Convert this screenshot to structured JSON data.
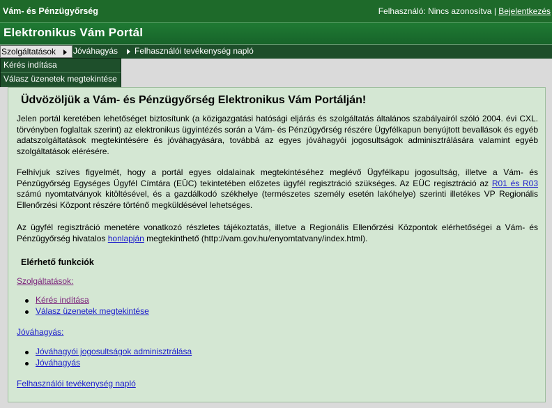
{
  "header": {
    "brand": "Vám- és Pénzügyőrség",
    "user_label": "Felhasználó: Nincs azonosítva",
    "separator": "|",
    "login_link": "Bejelentkezés"
  },
  "portal_title": "Elektronikus Vám Portál",
  "menu": {
    "items": [
      {
        "label": "Szolgáltatások"
      },
      {
        "label": "Jóváhagyás"
      },
      {
        "label": "Felhasználói tevékenység napló"
      }
    ]
  },
  "dropdown": {
    "items": [
      {
        "label": "Kérés indítása"
      },
      {
        "label": "Válasz üzenetek megtekintése"
      }
    ]
  },
  "content": {
    "welcome": "Üdvözöljük a Vám- és Pénzügyőrség Elektronikus Vám Portálján!",
    "p1": "Jelen portál keretében lehetőséget biztosítunk (a közigazgatási hatósági eljárás és szolgáltatás általános szabályairól szóló 2004. évi CXL. törvényben foglaltak szerint) az elektronikus ügyintézés során a Vám- és Pénzügyőrség részére Ügyfélkapun benyújtott bevallások és egyéb adatszolgáltatások megtekintésére és jóváhagyására, továbbá az egyes jóváhagyói jogosultságok adminisztrálására valamint egyéb szolgáltatások elérésére.",
    "p2_before": "Felhívjuk szíves figyelmét, hogy a portál egyes oldalainak megtekintéséhez meglévő Ügyfélkapu jogosultság, illetve a Vám- és Pénzügyőrség Egységes Ügyfél Címtára (EÜC) tekintetében előzetes ügyfél regisztráció szükséges. Az EÜC regisztráció az ",
    "p2_link": "R01 és R03",
    "p2_after": " számú nyomtatványok kitöltésével, és a gazdálkodó székhelye (természetes személy esetén lakóhelye) szerinti illetékes VP Regionális Ellenőrzési Központ részére történő megküldésével lehetséges.",
    "p3_before": "Az ügyfél regisztráció menetére vonatkozó részletes tájékoztatás, illetve a Regionális Ellenőrzési Központok elérhetőségei a Vám- és Pénzügyőrség hivatalos ",
    "p3_link": "honlapján",
    "p3_after": " megtekinthető (http://vam.gov.hu/enyomtatvany/index.html).",
    "functions_title": "Elérhető funkciók",
    "sections": [
      {
        "title": "Szolgáltatások:",
        "links": [
          "Kérés indítása",
          "Válasz üzenetek megtekintése"
        ]
      },
      {
        "title": "Jóváhagyás:",
        "links": [
          "Jóváhagyói jogosultságok adminisztrálása",
          "Jóváhagyás"
        ]
      }
    ],
    "log_link": "Felhasználói tevékenység napló"
  }
}
